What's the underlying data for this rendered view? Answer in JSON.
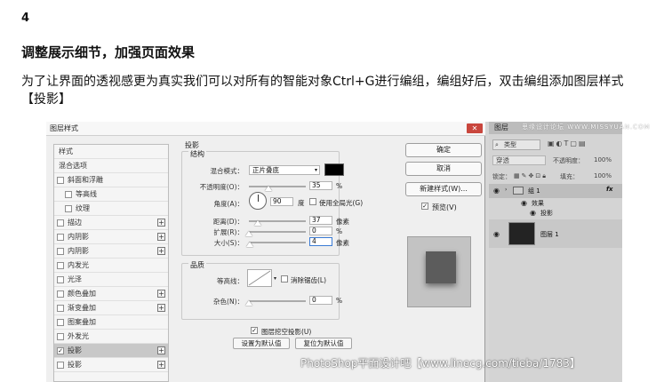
{
  "step_number": "4",
  "section_title": "调整展示细节，加强页面效果",
  "paragraph": "为了让界面的透视感更为真实我们可以对所有的智能对象Ctrl+G进行编组，编组好后，双击编组添加图层样式【投影】",
  "dialog": {
    "title": "图层样式",
    "close_icon": "close-icon",
    "style_list": [
      {
        "label": "样式",
        "checkbox": false,
        "plus": false,
        "sub": false,
        "checked": false
      },
      {
        "label": "混合选项",
        "checkbox": false,
        "plus": false,
        "sub": false,
        "checked": false
      },
      {
        "label": "斜面和浮雕",
        "checkbox": true,
        "plus": false,
        "sub": false,
        "checked": false
      },
      {
        "label": "等高线",
        "checkbox": true,
        "plus": false,
        "sub": true,
        "checked": false
      },
      {
        "label": "纹理",
        "checkbox": true,
        "plus": false,
        "sub": true,
        "checked": false
      },
      {
        "label": "描边",
        "checkbox": true,
        "plus": true,
        "sub": false,
        "checked": false
      },
      {
        "label": "内阴影",
        "checkbox": true,
        "plus": true,
        "sub": false,
        "checked": false
      },
      {
        "label": "内阴影",
        "checkbox": true,
        "plus": true,
        "sub": false,
        "checked": false
      },
      {
        "label": "内发光",
        "checkbox": true,
        "plus": false,
        "sub": false,
        "checked": false
      },
      {
        "label": "光泽",
        "checkbox": true,
        "plus": false,
        "sub": false,
        "checked": false
      },
      {
        "label": "颜色叠加",
        "checkbox": true,
        "plus": true,
        "sub": false,
        "checked": false
      },
      {
        "label": "渐变叠加",
        "checkbox": true,
        "plus": true,
        "sub": false,
        "checked": false
      },
      {
        "label": "图案叠加",
        "checkbox": true,
        "plus": false,
        "sub": false,
        "checked": false
      },
      {
        "label": "外发光",
        "checkbox": true,
        "plus": false,
        "sub": false,
        "checked": false
      },
      {
        "label": "投影",
        "checkbox": true,
        "plus": true,
        "sub": false,
        "checked": true,
        "selected": true
      },
      {
        "label": "投影",
        "checkbox": true,
        "plus": true,
        "sub": false,
        "checked": false
      }
    ],
    "shadow": {
      "group_title": "投影",
      "structure_title": "结构",
      "blend_mode_label": "混合模式：",
      "blend_mode_value": "正片叠底",
      "blend_color": "#000000",
      "opacity_label": "不透明度(O)：",
      "opacity_value": "35",
      "opacity_unit": "%",
      "opacity_fraction": 0.35,
      "angle_label": "角度(A)：",
      "angle_value": "90",
      "angle_unit": "度",
      "global_light_label": "使用全局光(G)",
      "global_light_checked": false,
      "distance_label": "距离(D)：",
      "distance_value": "37",
      "distance_unit": "像素",
      "distance_fraction": 0.15,
      "spread_label": "扩展(R)：",
      "spread_value": "0",
      "spread_unit": "%",
      "spread_fraction": 0.0,
      "size_label": "大小(S)：",
      "size_value": "4",
      "size_unit": "像素",
      "size_fraction": 0.02,
      "quality_title": "品质",
      "contour_label": "等高线：",
      "antialias_label": "消除锯齿(L)",
      "antialias_checked": false,
      "noise_label": "杂色(N)：",
      "noise_value": "0",
      "noise_unit": "%",
      "noise_fraction": 0.0,
      "knockout_label": "图层挖空投影(U)",
      "knockout_checked": true,
      "make_default_label": "设置为默认值",
      "reset_default_label": "复位为默认值"
    },
    "buttons": {
      "ok": "确定",
      "cancel": "取消",
      "new_style": "新建样式(W)...",
      "preview_label": "预览(V)",
      "preview_checked": true
    }
  },
  "layers_panel": {
    "tab_label": "图层",
    "filter_label": "类型",
    "blend_mode": "穿透",
    "opacity_label": "不透明度：",
    "opacity_value": "100%",
    "lock_label": "锁定：",
    "fill_label": "填充：",
    "fill_value": "100%",
    "layers": [
      {
        "name": "组 1",
        "type": "group",
        "fx": "fx"
      },
      {
        "name": "效果",
        "type": "effect-header"
      },
      {
        "name": "投影",
        "type": "effect"
      },
      {
        "name": "图层 1",
        "type": "layer"
      }
    ]
  },
  "watermark_top": "思缘设计论坛 WWW.MISSYUAN.COM",
  "watermark_bottom": "PhotoShop平面设计吧【www.linecg.com/tieba/1783】"
}
